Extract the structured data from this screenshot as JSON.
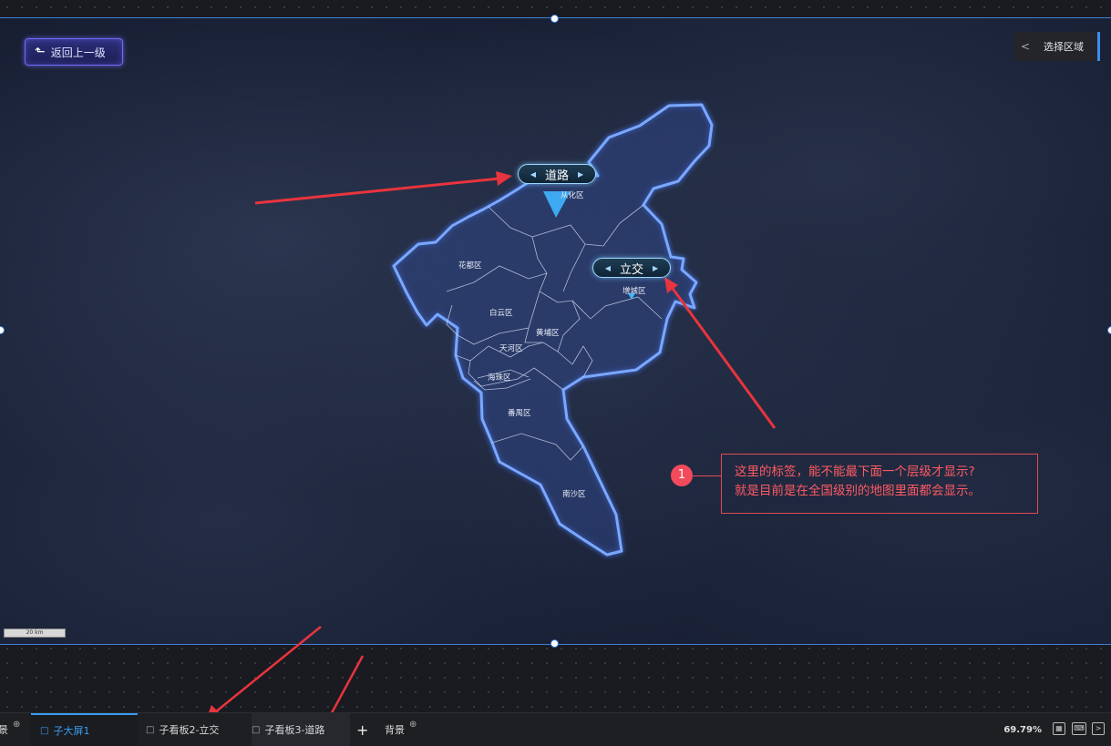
{
  "toolbar": {
    "back_label": "返回上一级"
  },
  "region_panel": {
    "chevron": "<",
    "label": "选择区域"
  },
  "map": {
    "labels": [
      {
        "id": "road",
        "text": "道路"
      },
      {
        "id": "interchange",
        "text": "立交"
      }
    ],
    "districts": [
      "从化区",
      "花都区",
      "增城区",
      "白云区",
      "黄埔区",
      "天河区",
      "海珠区",
      "番禺区",
      "南沙区"
    ],
    "scale_bar": "20 km"
  },
  "annotation": {
    "number": "1",
    "line1": "这里的标签，能不能最下面一个层级才显示?",
    "line2": "就是目前是在全国级别的地图里面都会显示。"
  },
  "tabs": [
    {
      "label": "景",
      "icon": "plus-circle-icon",
      "active": false
    },
    {
      "label": "子大屏1",
      "icon": "monitor-icon",
      "active": true
    },
    {
      "label": "子看板2-立交",
      "icon": "monitor-icon",
      "active": false
    },
    {
      "label": "子看板3-道路",
      "icon": "monitor-icon",
      "active": false
    },
    {
      "label": "背景",
      "icon": "plus-circle-icon",
      "active": false
    }
  ],
  "add_tab": "+",
  "zoom": "69.79%",
  "colors": {
    "accent": "#3c9cf4",
    "annotation": "#e24a55",
    "boundary": "#7aa8ff"
  }
}
